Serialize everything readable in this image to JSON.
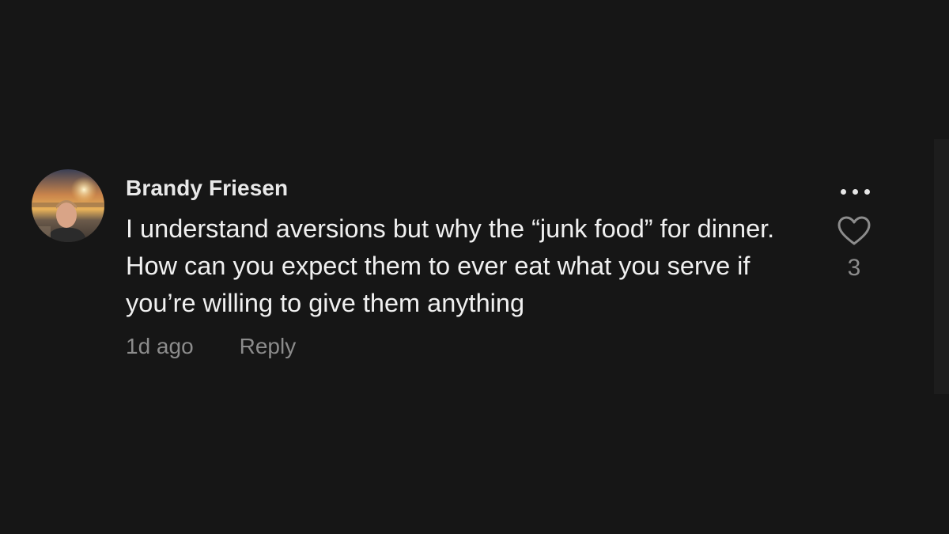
{
  "comment": {
    "username": "Brandy Friesen",
    "text": "I understand aversions but why the “junk food” for dinner. How can you expect them to ever eat what you serve if you’re willing to give them anything",
    "timestamp": "1d ago",
    "reply_label": "Reply",
    "like_count": "3"
  },
  "icons": {
    "more": "more-options-icon",
    "like": "heart-outline-icon"
  },
  "colors": {
    "background": "#161616",
    "primary_text": "#f0f0f0",
    "secondary_text": "#8c8c8c"
  }
}
